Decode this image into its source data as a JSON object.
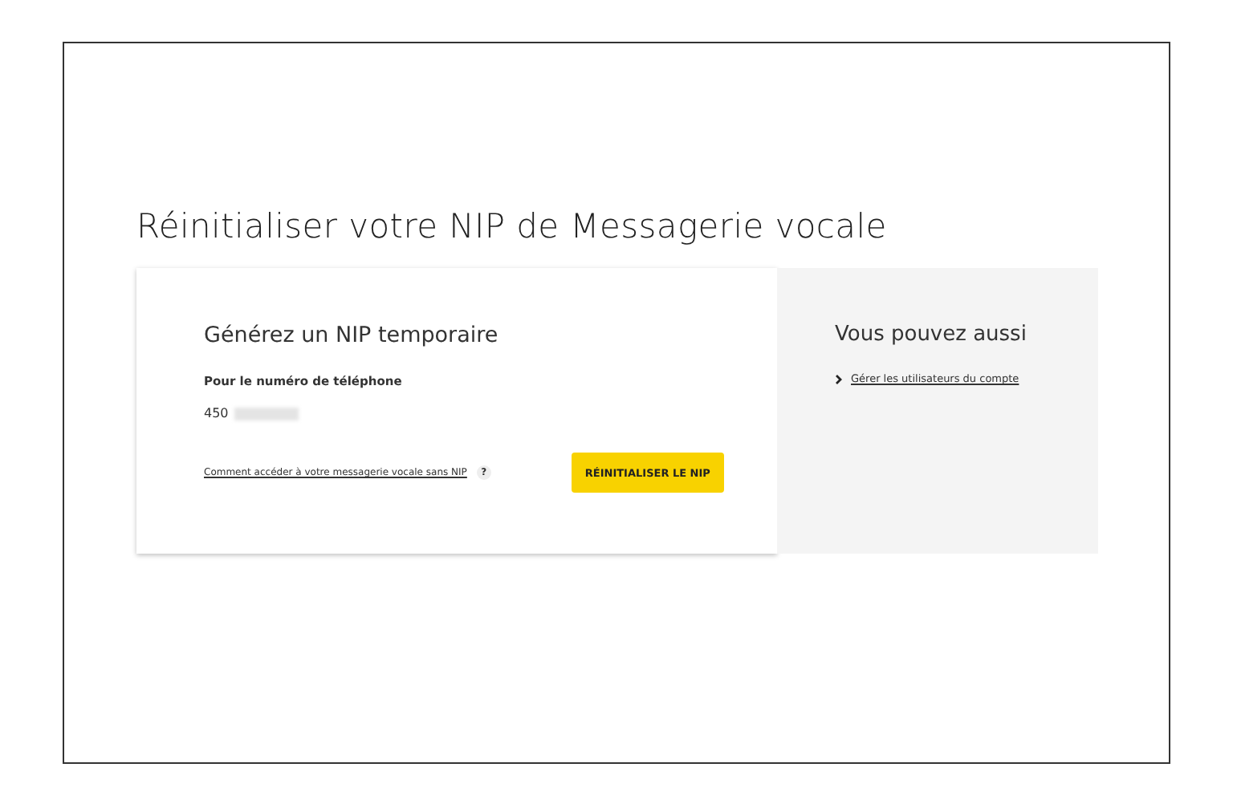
{
  "page_title": "Réinitialiser votre NIP de Messagerie vocale",
  "card": {
    "title": "Générez un NIP temporaire",
    "phone_label": "Pour le numéro de téléphone",
    "phone_prefix": "450",
    "help_link": "Comment accéder à votre messagerie vocale sans NIP",
    "help_icon": "?",
    "button": "RÉINITIALISER LE NIP"
  },
  "aside": {
    "title": "Vous pouvez aussi",
    "links": [
      {
        "label": "Gérer les utilisateurs du compte"
      }
    ]
  }
}
